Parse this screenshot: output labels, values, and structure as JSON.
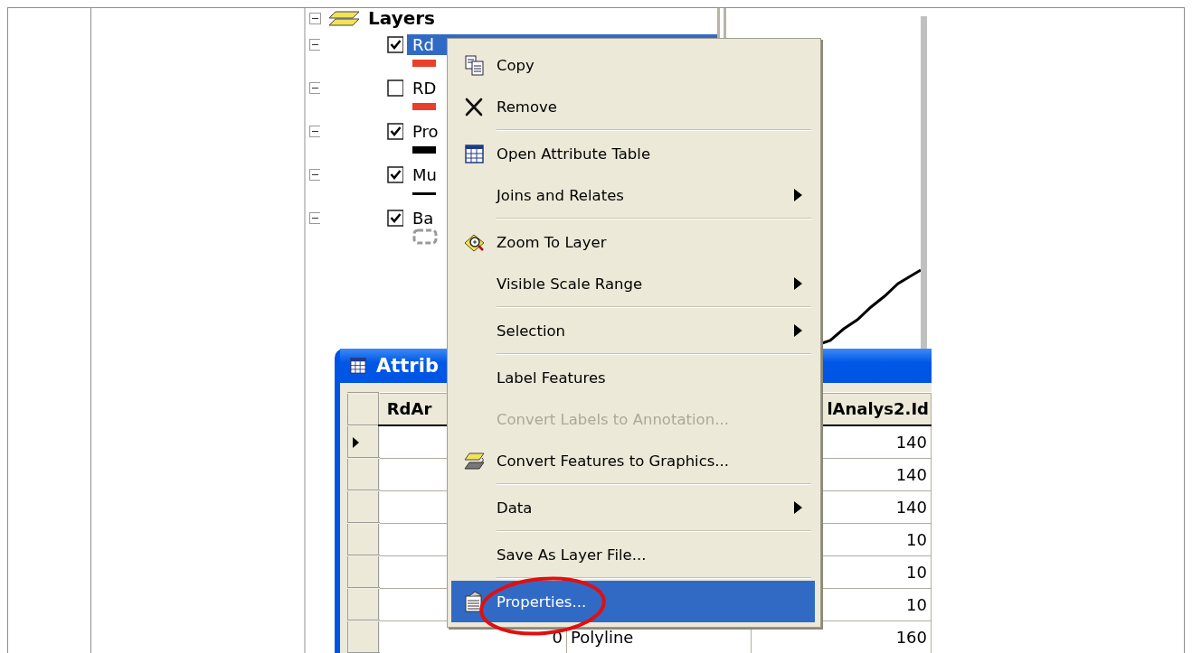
{
  "layers_panel": {
    "title": "Layers",
    "expanded": true,
    "layers": [
      {
        "name": "Rd",
        "checked": true,
        "selected": true,
        "expanded": true,
        "symbol": {
          "kind": "thick_line",
          "color": "#e8402a"
        }
      },
      {
        "name": "RD",
        "checked": false,
        "selected": false,
        "expanded": true,
        "symbol": {
          "kind": "thick_line",
          "color": "#e8402a"
        }
      },
      {
        "name": "Pro",
        "checked": true,
        "selected": false,
        "expanded": true,
        "symbol": {
          "kind": "thick_line",
          "color": "#000000"
        }
      },
      {
        "name": "Mu",
        "checked": true,
        "selected": false,
        "expanded": true,
        "symbol": {
          "kind": "thin_line",
          "color": "#000000"
        }
      },
      {
        "name": "Ba",
        "checked": true,
        "selected": false,
        "expanded": true,
        "symbol": {
          "kind": "outline",
          "color": "#9a9a9a"
        }
      }
    ]
  },
  "attribute_window": {
    "title": "Attrib",
    "columns": [
      "RdAr",
      "",
      "lAnalys2.Id"
    ],
    "rows": [
      {
        "current": true,
        "cells": [
          "",
          "",
          "140"
        ]
      },
      {
        "current": false,
        "cells": [
          "",
          "",
          "140"
        ]
      },
      {
        "current": false,
        "cells": [
          "",
          "",
          "140"
        ]
      },
      {
        "current": false,
        "cells": [
          "",
          "",
          "10"
        ]
      },
      {
        "current": false,
        "cells": [
          "",
          "",
          "10"
        ]
      },
      {
        "current": false,
        "cells": [
          "",
          "",
          "10"
        ]
      },
      {
        "current": false,
        "cells": [
          "0",
          "Polyline",
          "160"
        ]
      }
    ]
  },
  "context_menu": {
    "items": [
      {
        "kind": "item",
        "label": "Copy",
        "disabled": false,
        "selected": false,
        "submenu": false
      },
      {
        "kind": "item",
        "label": "Remove",
        "disabled": false,
        "selected": false,
        "submenu": false
      },
      {
        "kind": "separator"
      },
      {
        "kind": "item",
        "label": "Open Attribute Table",
        "disabled": false,
        "selected": false,
        "submenu": false
      },
      {
        "kind": "item",
        "label": "Joins and Relates",
        "disabled": false,
        "selected": false,
        "submenu": true
      },
      {
        "kind": "separator"
      },
      {
        "kind": "item",
        "label": "Zoom To Layer",
        "disabled": false,
        "selected": false,
        "submenu": false
      },
      {
        "kind": "item",
        "label": "Visible Scale Range",
        "disabled": false,
        "selected": false,
        "submenu": true
      },
      {
        "kind": "separator"
      },
      {
        "kind": "item",
        "label": "Selection",
        "disabled": false,
        "selected": false,
        "submenu": true
      },
      {
        "kind": "separator"
      },
      {
        "kind": "item",
        "label": "Label Features",
        "disabled": false,
        "selected": false,
        "submenu": false
      },
      {
        "kind": "item",
        "label": "Convert Labels to Annotation...",
        "disabled": true,
        "selected": false,
        "submenu": false
      },
      {
        "kind": "item",
        "label": "Convert Features to Graphics...",
        "disabled": false,
        "selected": false,
        "submenu": false
      },
      {
        "kind": "separator"
      },
      {
        "kind": "item",
        "label": "Data",
        "disabled": false,
        "selected": false,
        "submenu": true
      },
      {
        "kind": "separator"
      },
      {
        "kind": "item",
        "label": "Save As Layer File...",
        "disabled": false,
        "selected": false,
        "submenu": false
      },
      {
        "kind": "separator"
      },
      {
        "kind": "item",
        "label": "Properties...",
        "disabled": false,
        "selected": true,
        "submenu": false,
        "circled": true
      }
    ]
  }
}
